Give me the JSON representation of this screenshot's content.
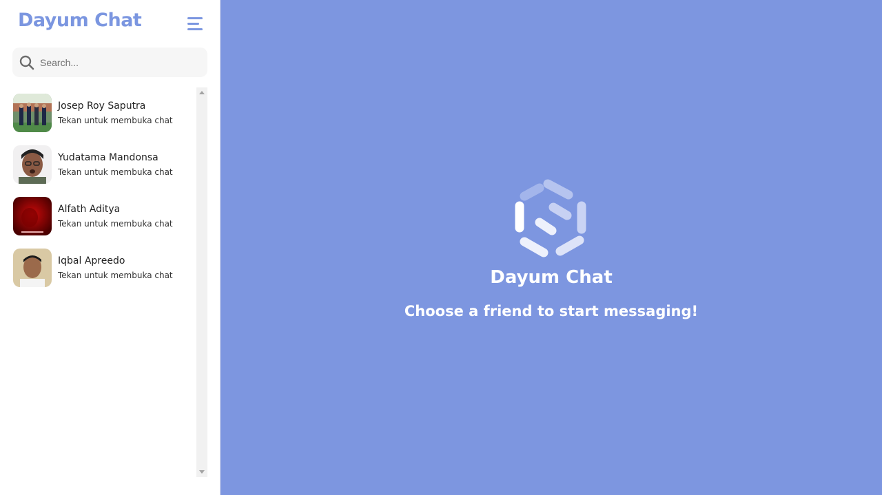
{
  "sidebar": {
    "brand": "Dayum Chat",
    "menu_icon": "hamburger-menu-icon",
    "search": {
      "placeholder": "Search...",
      "value": "",
      "icon": "search-icon"
    },
    "contacts": [
      {
        "name": "Josep Roy Saputra",
        "subtitle": "Tekan untuk membuka chat"
      },
      {
        "name": "Yudatama Mandonsa",
        "subtitle": "Tekan untuk membuka chat"
      },
      {
        "name": "Alfath Aditya",
        "subtitle": "Tekan untuk membuka chat"
      },
      {
        "name": "Iqbal Apreedo",
        "subtitle": "Tekan untuk membuka chat"
      }
    ]
  },
  "main": {
    "logo_icon": "hexagon-swirl-logo-icon",
    "title": "Dayum Chat",
    "subtitle": "Choose a friend to start messaging!"
  },
  "colors": {
    "accent": "#7b96e0",
    "main_background": "#7d96e0",
    "search_background": "#f6f6f6"
  }
}
